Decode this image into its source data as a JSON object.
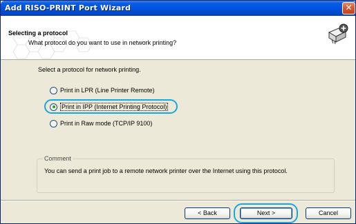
{
  "window": {
    "title": "Add RISO-PRINT Port Wizard",
    "close_glyph": "✕"
  },
  "header": {
    "title": "Selecting a protocol",
    "subtitle": "What protocol do you want to use in network printing?",
    "icon": "network-printer-plus-icon"
  },
  "main": {
    "prompt": "Select a protocol for network printing.",
    "options": [
      {
        "label": "Print in LPR (Line Printer Remote)",
        "checked": false
      },
      {
        "label": "Print in IPP (Internet Printing Protocol)",
        "checked": true
      },
      {
        "label": "Print in Raw mode (TCP/IP 9100)",
        "checked": false
      }
    ],
    "comment": {
      "legend": "Comment",
      "text": "You can send a print job to a remote network printer over the Internet using this protocol."
    }
  },
  "buttons": {
    "back": "< Back",
    "next": "Next >",
    "cancel": "Cancel"
  },
  "colors": {
    "titlebar": "#0054e3",
    "highlight": "#1aa6d8",
    "radio_dot": "#21a121"
  }
}
